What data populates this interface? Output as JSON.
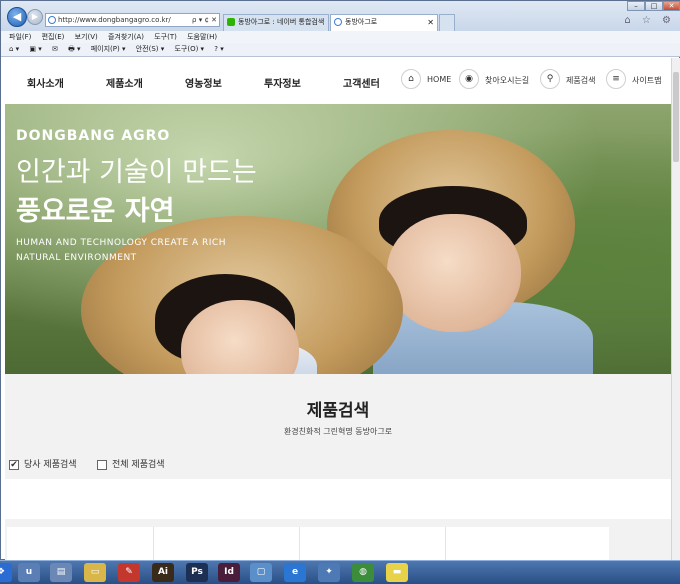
{
  "browser": {
    "url": "http://www.dongbangagro.co.kr/",
    "url_tools": "ρ ▾ ¢ ✕",
    "tabs": [
      {
        "label": "동방아그로 : 네이버 통합검색",
        "fav_color": "#2db400",
        "active": false
      },
      {
        "label": "동방아그로",
        "fav_color": "#3c7ed6",
        "active": true
      }
    ],
    "tab_close": "✕",
    "back_icon": "back-arrow-icon",
    "forward_icon": "forward-arrow-icon",
    "window_controls": [
      "–",
      "□",
      "✕"
    ],
    "right_icons": "⌂ ☆ ⚙",
    "menu": [
      "파일(F)",
      "편집(E)",
      "보기(V)",
      "즐겨찾기(A)",
      "도구(T)",
      "도움말(H)"
    ],
    "commands": [
      "⌂ ▾",
      "▣ ▾",
      "✉",
      "🖶 ▾",
      "페이지(P) ▾",
      "안전(S) ▾",
      "도구(O) ▾",
      "? ▾"
    ]
  },
  "site": {
    "nav": [
      "회사소개",
      "제품소개",
      "영농정보",
      "투자정보",
      "고객센터"
    ],
    "util": [
      {
        "icon": "⌂",
        "label": "HOME"
      },
      {
        "icon": "◉",
        "label": "찾아오시는길"
      },
      {
        "icon": "⚲",
        "label": "제품검색"
      },
      {
        "icon": "≡",
        "label": "사이트맵"
      }
    ],
    "hero": {
      "brand": "DONGBANG AGRO",
      "headline1": "인간과 기술이 만드는",
      "headline2": "풍요로운 자연",
      "en_line1": "HUMAN AND TECHNOLOGY CREATE A RICH",
      "en_line2": "NATURAL ENVIRONMENT"
    },
    "search": {
      "title": "제품검색",
      "subtitle": "환경친화적 그린혁명 동방아그로",
      "options": [
        {
          "label": "당사 제품검색",
          "checked": true
        },
        {
          "label": "전체 제품검색",
          "checked": false
        }
      ]
    }
  },
  "taskbar": {
    "apps": [
      {
        "icon": "windows-start-icon",
        "glyph": "❖",
        "color": "#2b6cd4"
      },
      {
        "icon": "uplay-icon",
        "glyph": "u",
        "color": "#5b7fb4"
      },
      {
        "icon": "notepad-icon",
        "glyph": "▤",
        "color": "#6b87b6"
      },
      {
        "icon": "folder-icon",
        "glyph": "▭",
        "color": "#d9b64a"
      },
      {
        "icon": "pdf-icon",
        "glyph": "✎",
        "color": "#c4372c"
      },
      {
        "icon": "illustrator-icon",
        "glyph": "Ai",
        "color": "#3a2a1a"
      },
      {
        "icon": "photoshop-icon",
        "glyph": "Ps",
        "color": "#1d2f52"
      },
      {
        "icon": "indesign-icon",
        "glyph": "Id",
        "color": "#4a1e3a"
      },
      {
        "icon": "app-icon",
        "glyph": "▢",
        "color": "#5b8fc9"
      },
      {
        "icon": "internet-explorer-icon",
        "glyph": "e",
        "color": "#2a76d2"
      },
      {
        "icon": "remote-icon",
        "glyph": "✦",
        "color": "#4d79b5"
      },
      {
        "icon": "chrome-icon",
        "glyph": "◍",
        "color": "#3b8c3b"
      },
      {
        "icon": "sticky-notes-icon",
        "glyph": "▬",
        "color": "#e7d24a"
      }
    ]
  }
}
